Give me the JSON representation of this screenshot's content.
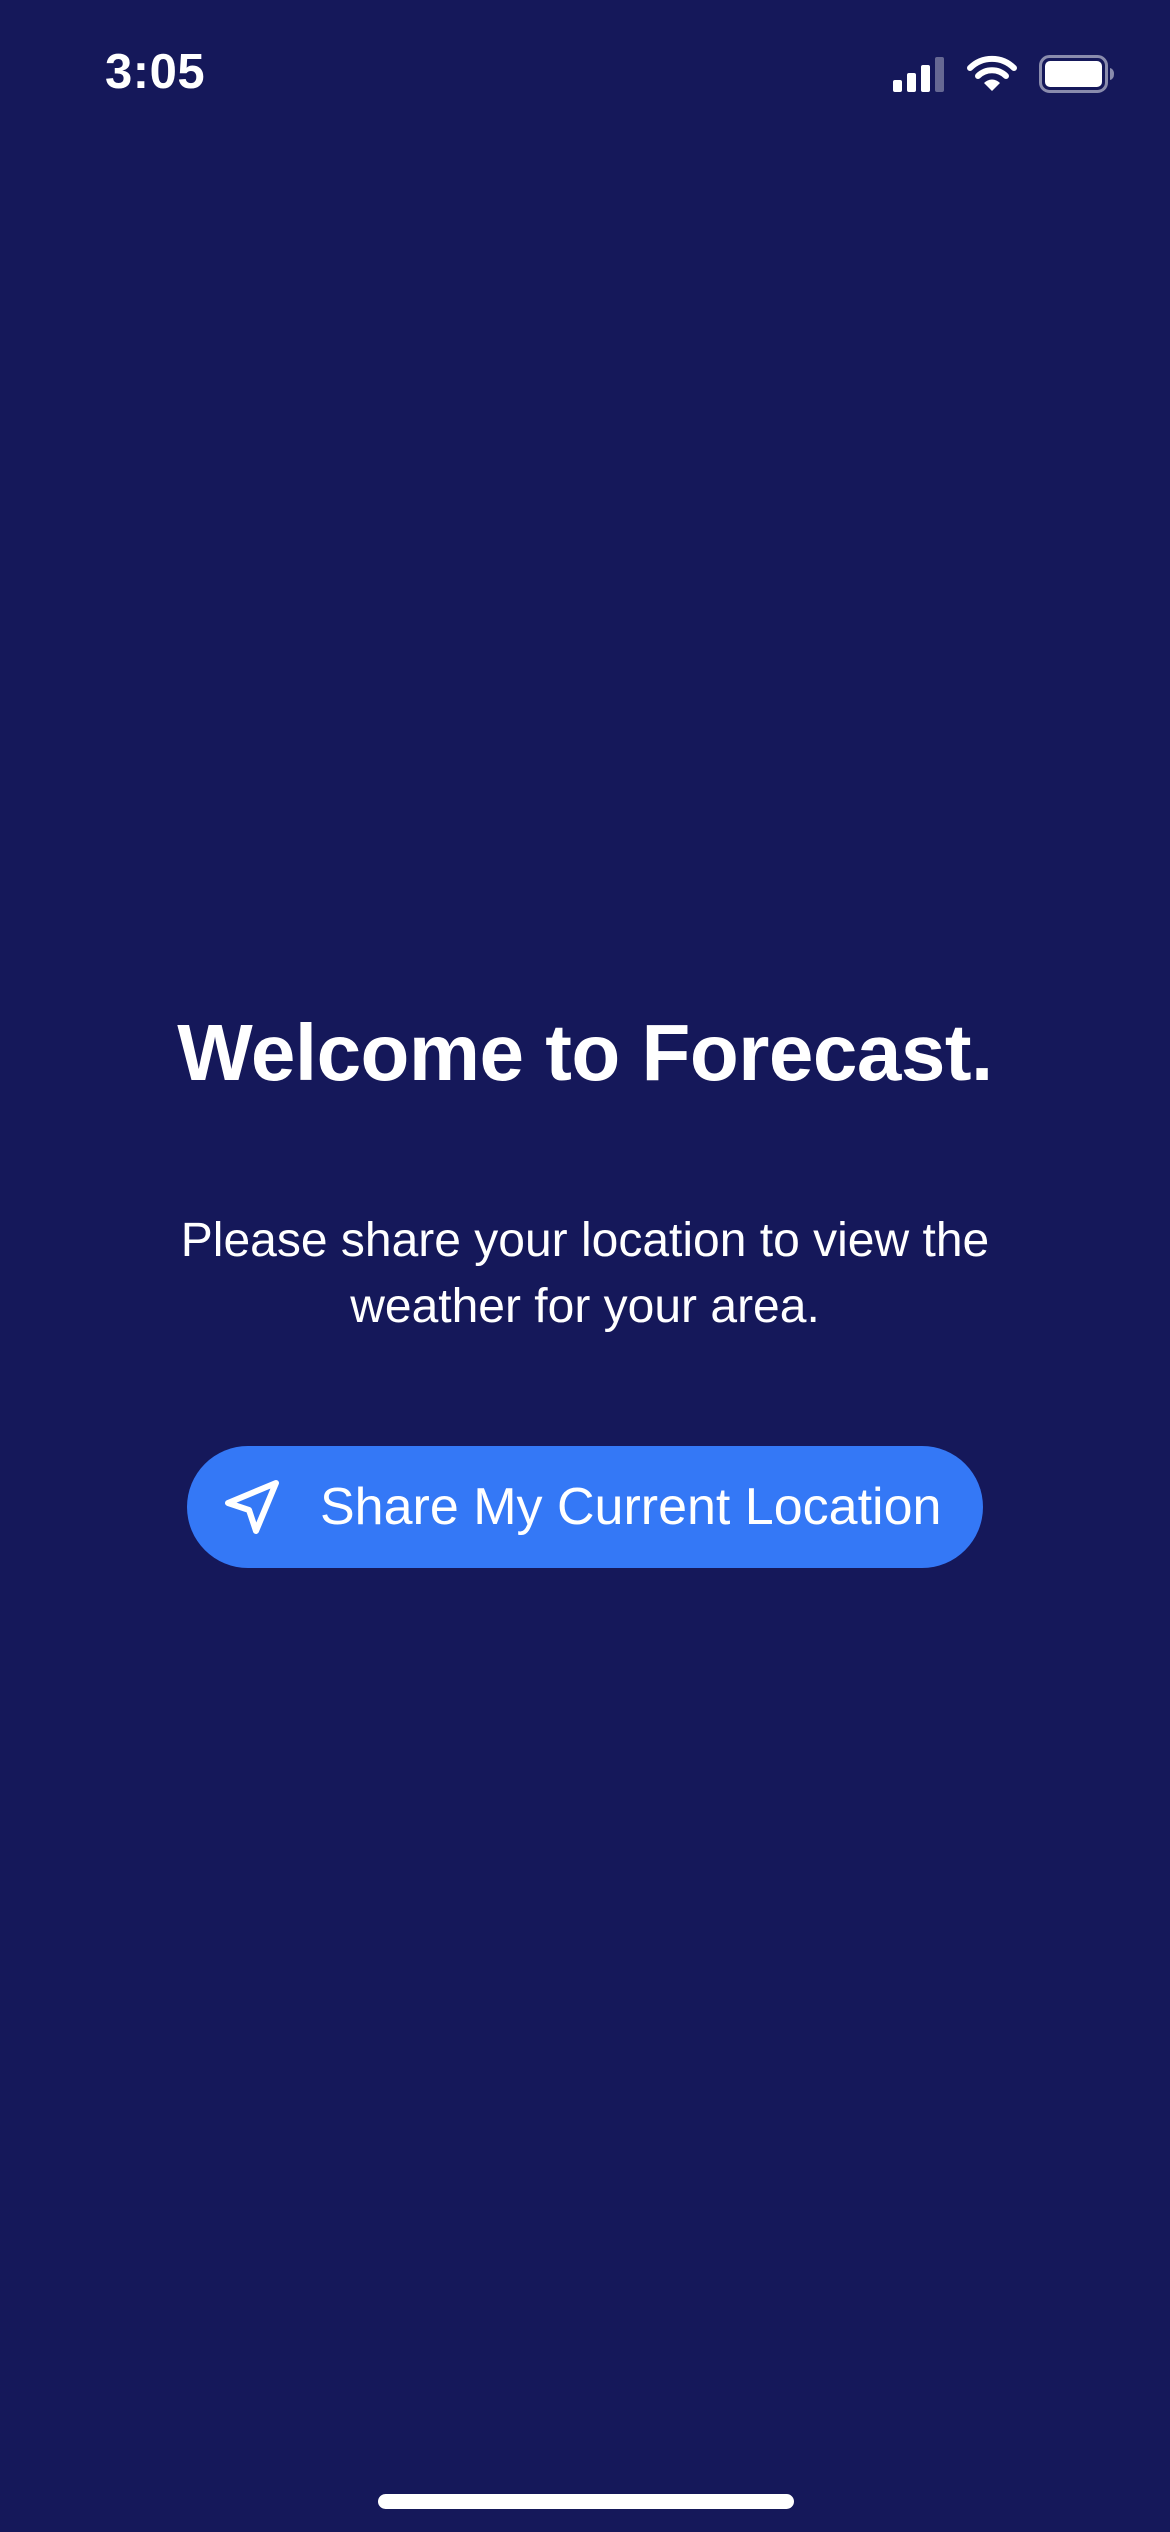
{
  "status_bar": {
    "time": "3:05",
    "icons": [
      "signal-icon",
      "wifi-icon",
      "battery-icon"
    ]
  },
  "welcome": {
    "title": "Welcome to Forecast.",
    "message": "Please share your location to view the weather for your area."
  },
  "share_button": {
    "label": "Share My Current Location",
    "icon": "location-arrow-icon"
  },
  "colors": {
    "background": "#15185A",
    "button": "#3478F6",
    "text": "#FFFFFF"
  }
}
